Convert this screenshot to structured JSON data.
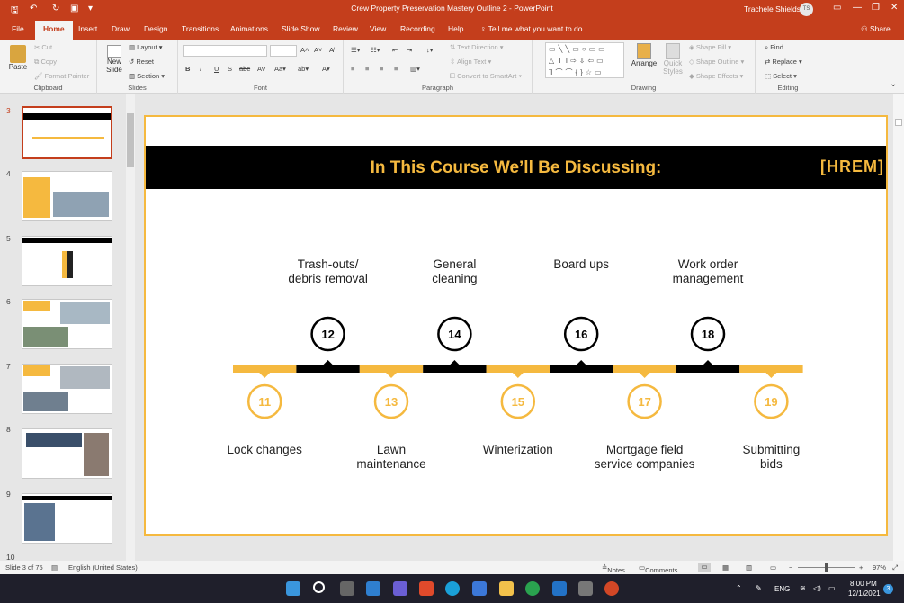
{
  "window": {
    "title": "Crew Property Preservation Mastery Outline 2  -  PowerPoint",
    "user_name": "Trachele Shields",
    "user_initials": "TS"
  },
  "tabs": [
    "File",
    "Home",
    "Insert",
    "Draw",
    "Design",
    "Transitions",
    "Animations",
    "Slide Show",
    "Review",
    "View",
    "Recording",
    "Help"
  ],
  "tell_me": "Tell me what you want to do",
  "share": "Share",
  "ribbon": {
    "clipboard": {
      "paste": "Paste",
      "cut": "Cut",
      "copy": "Copy",
      "format_painter": "Format Painter",
      "label": "Clipboard"
    },
    "slides": {
      "new_slide": "New Slide",
      "layout": "Layout",
      "reset": "Reset",
      "section": "Section",
      "label": "Slides"
    },
    "font": {
      "label": "Font"
    },
    "paragraph": {
      "text_direction": "Text Direction",
      "align_text": "Align Text",
      "smartart": "Convert to SmartArt",
      "label": "Paragraph"
    },
    "drawing": {
      "arrange": "Arrange",
      "quick_styles": "Quick Styles",
      "shape_fill": "Shape Fill",
      "shape_outline": "Shape Outline",
      "shape_effects": "Shape Effects",
      "label": "Drawing"
    },
    "editing": {
      "find": "Find",
      "replace": "Replace",
      "select": "Select",
      "label": "Editing"
    }
  },
  "thumbnails": [
    {
      "num": "3",
      "selected": true
    },
    {
      "num": "4",
      "selected": false
    },
    {
      "num": "5",
      "selected": false
    },
    {
      "num": "6",
      "selected": false
    },
    {
      "num": "7",
      "selected": false
    },
    {
      "num": "8",
      "selected": false
    },
    {
      "num": "9",
      "selected": false
    },
    {
      "num": "10",
      "selected": false
    }
  ],
  "slide": {
    "title": "In This Course We’ll Be Discussing:",
    "logo": "[HREM]",
    "top_items": [
      {
        "num": "12",
        "label": "Trash-outs/\ndebris removal"
      },
      {
        "num": "14",
        "label": "General\ncleaning"
      },
      {
        "num": "16",
        "label": "Board ups"
      },
      {
        "num": "18",
        "label": "Work order\nmanagement"
      }
    ],
    "bottom_items": [
      {
        "num": "11",
        "label": "Lock changes"
      },
      {
        "num": "13",
        "label": "Lawn\nmaintenance"
      },
      {
        "num": "15",
        "label": "Winterization"
      },
      {
        "num": "17",
        "label": "Mortgage field\nservice companies"
      },
      {
        "num": "19",
        "label": "Submitting\nbids"
      }
    ],
    "colors": {
      "accent": "#f5b93f",
      "dark": "#000000"
    }
  },
  "status": {
    "slide_info": "Slide 3 of 75",
    "language": "English (United States)",
    "notes": "Notes",
    "comments": "Comments",
    "zoom": "97%"
  },
  "taskbar": {
    "lang": "ENG",
    "time": "8:00 PM",
    "date": "12/1/2021",
    "notif": "3"
  }
}
